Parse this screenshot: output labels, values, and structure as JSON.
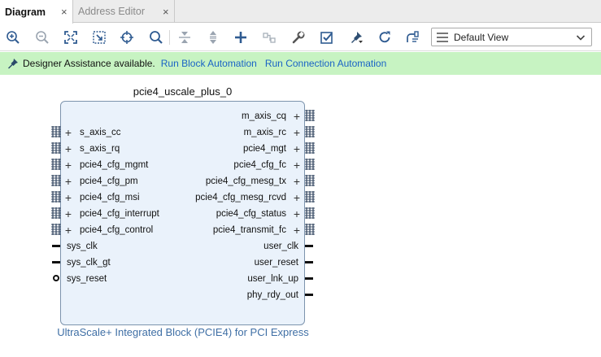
{
  "tabs": [
    {
      "label": "Diagram",
      "active": true,
      "close": "×"
    },
    {
      "label": "Address Editor",
      "active": false,
      "close": "×"
    }
  ],
  "toolbar": {
    "icons": [
      "zoom-in-icon",
      "zoom-out-icon",
      "zoom-fit-icon",
      "zoom-selection-icon",
      "center-icon",
      "search-icon",
      "collapse-icon",
      "expand-icon",
      "add-ip-icon",
      "make-connection-icon",
      "properties-wrench-icon",
      "validate-design-icon",
      "pin-autoconnect-icon",
      "regenerate-layout-icon",
      "optimize-routing-icon"
    ],
    "view_select": "Default View"
  },
  "banner": {
    "message": "Designer Assistance available.",
    "run_block_automation": "Run Block Automation",
    "run_connection_automation": "Run Connection Automation",
    "color": "#c7f3c2"
  },
  "block": {
    "instance_name": "pcie4_uscale_plus_0",
    "ip_name": "UltraScale+ Integrated Block (PCIE4) for PCI Express",
    "left_bus_ports": [
      "s_axis_cc",
      "s_axis_rq",
      "pcie4_cfg_mgmt",
      "pcie4_cfg_pm",
      "pcie4_cfg_msi",
      "pcie4_cfg_interrupt",
      "pcie4_cfg_control"
    ],
    "left_ports": [
      "sys_clk",
      "sys_clk_gt",
      "sys_reset"
    ],
    "right_bus_ports": [
      "m_axis_cq",
      "m_axis_rc",
      "pcie4_mgt",
      "pcie4_cfg_fc",
      "pcie4_cfg_mesg_tx",
      "pcie4_cfg_mesg_rcvd",
      "pcie4_cfg_status",
      "pcie4_transmit_fc"
    ],
    "right_ports": [
      "user_clk",
      "user_reset",
      "user_lnk_up",
      "phy_rdy_out"
    ],
    "fill_color": "#eaf2fb",
    "border_color": "#7d94ad",
    "subtitle_color": "#3f6fa5"
  }
}
